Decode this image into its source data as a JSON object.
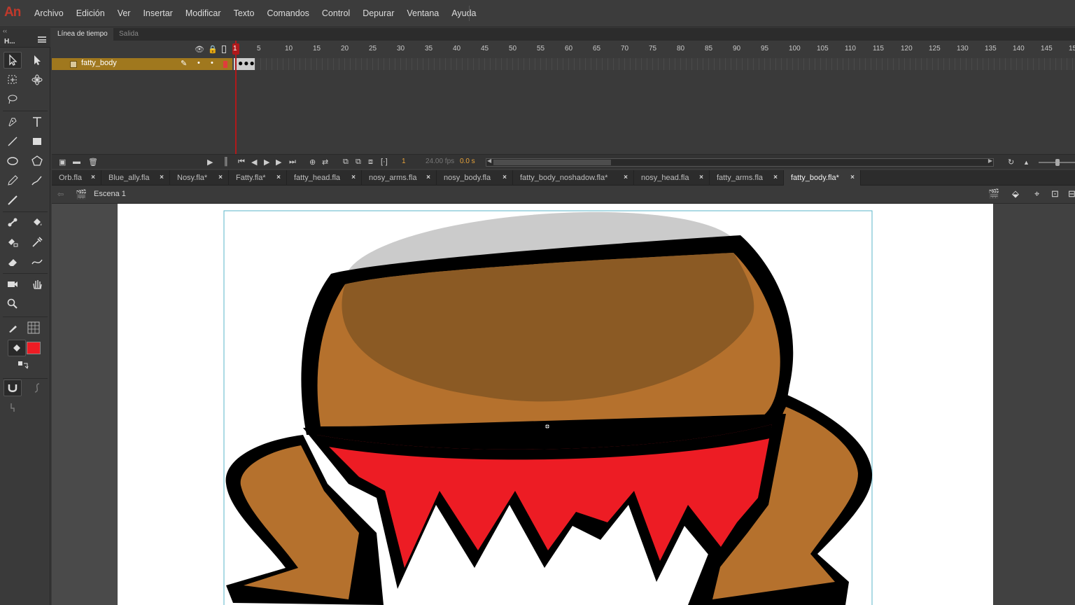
{
  "app": {
    "logo": "An"
  },
  "menu": [
    "Archivo",
    "Edición",
    "Ver",
    "Insertar",
    "Modificar",
    "Texto",
    "Comandos",
    "Control",
    "Depurar",
    "Ventana",
    "Ayuda"
  ],
  "toolbar": {
    "title": "H...",
    "collapse": "‹‹",
    "fill_color": "#ed1c24"
  },
  "timeline": {
    "tabs": [
      "Línea de tiempo",
      "Salida"
    ],
    "layer": {
      "name": "fatty_body",
      "color": "#a0781e"
    },
    "frame_numbers": [
      "1",
      "5",
      "10",
      "15",
      "20",
      "25",
      "30",
      "35",
      "40",
      "45",
      "50",
      "55",
      "60",
      "65",
      "70",
      "75",
      "80",
      "85",
      "90",
      "95",
      "100",
      "105",
      "110",
      "115",
      "120",
      "125",
      "130",
      "135",
      "140",
      "145",
      "15"
    ],
    "current_frame": "1",
    "fps": "24.00 fps",
    "time": "0.0 s"
  },
  "documents": [
    {
      "name": "Orb.fla",
      "active": false
    },
    {
      "name": "Blue_ally.fla",
      "active": false
    },
    {
      "name": "Nosy.fla*",
      "active": false
    },
    {
      "name": "Fatty.fla*",
      "active": false
    },
    {
      "name": "fatty_head.fla",
      "active": false
    },
    {
      "name": "nosy_arms.fla",
      "active": false
    },
    {
      "name": "nosy_body.fla",
      "active": false
    },
    {
      "name": "fatty_body_noshadow.fla*",
      "active": false
    },
    {
      "name": "nosy_head.fla",
      "active": false
    },
    {
      "name": "fatty_arms.fla",
      "active": false
    },
    {
      "name": "fatty_body.fla*",
      "active": true
    }
  ],
  "scene": {
    "name": "Escena 1"
  },
  "colors": {
    "accent": "#b0191b",
    "skin_dark": "#8b5a24",
    "skin_light": "#b5712d",
    "loincloth": "#ed1c24",
    "outline": "#000000"
  }
}
